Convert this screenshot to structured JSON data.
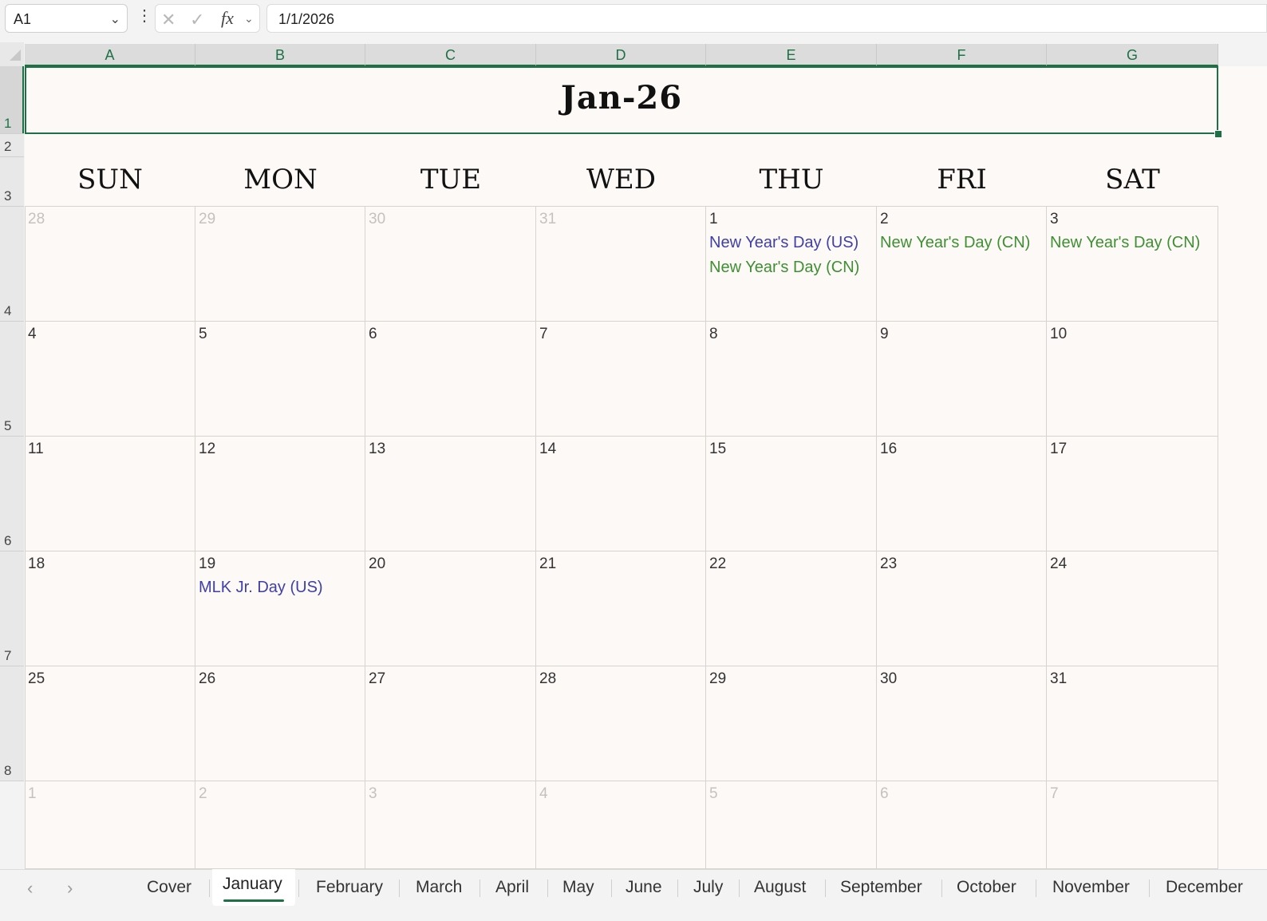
{
  "formula_bar": {
    "name_box": "A1",
    "formula": "1/1/2026"
  },
  "columns": [
    "A",
    "B",
    "C",
    "D",
    "E",
    "F",
    "G"
  ],
  "rows": [
    "1",
    "2",
    "3",
    "4",
    "5",
    "6",
    "7",
    "8"
  ],
  "calendar": {
    "title": "Jan-26",
    "day_names": [
      "SUN",
      "MON",
      "TUE",
      "WED",
      "THU",
      "FRI",
      "SAT"
    ],
    "weeks": [
      [
        {
          "d": "28",
          "o": true
        },
        {
          "d": "29",
          "o": true
        },
        {
          "d": "30",
          "o": true
        },
        {
          "d": "31",
          "o": true
        },
        {
          "d": "1",
          "h": [
            {
              "t": "New Year's Day (US)",
              "k": "us"
            },
            {
              "t": "New Year's Day (CN)",
              "k": "cn"
            }
          ]
        },
        {
          "d": "2",
          "h": [
            {
              "t": "New Year's Day (CN)",
              "k": "cn"
            }
          ]
        },
        {
          "d": "3",
          "h": [
            {
              "t": "New Year's Day (CN)",
              "k": "cn"
            }
          ]
        }
      ],
      [
        {
          "d": "4"
        },
        {
          "d": "5"
        },
        {
          "d": "6"
        },
        {
          "d": "7"
        },
        {
          "d": "8"
        },
        {
          "d": "9"
        },
        {
          "d": "10"
        }
      ],
      [
        {
          "d": "11"
        },
        {
          "d": "12"
        },
        {
          "d": "13"
        },
        {
          "d": "14"
        },
        {
          "d": "15"
        },
        {
          "d": "16"
        },
        {
          "d": "17"
        }
      ],
      [
        {
          "d": "18"
        },
        {
          "d": "19",
          "h": [
            {
              "t": "MLK Jr. Day (US)",
              "k": "us"
            }
          ]
        },
        {
          "d": "20"
        },
        {
          "d": "21"
        },
        {
          "d": "22"
        },
        {
          "d": "23"
        },
        {
          "d": "24"
        }
      ],
      [
        {
          "d": "25"
        },
        {
          "d": "26"
        },
        {
          "d": "27"
        },
        {
          "d": "28"
        },
        {
          "d": "29"
        },
        {
          "d": "30"
        },
        {
          "d": "31"
        }
      ],
      [
        {
          "d": "1",
          "o": true
        },
        {
          "d": "2",
          "o": true
        },
        {
          "d": "3",
          "o": true
        },
        {
          "d": "4",
          "o": true
        },
        {
          "d": "5",
          "o": true
        },
        {
          "d": "6",
          "o": true
        },
        {
          "d": "7",
          "o": true
        }
      ]
    ]
  },
  "sheet_tabs": {
    "active": "January",
    "tabs": [
      "Cover",
      "January",
      "February",
      "March",
      "April",
      "May",
      "June",
      "July",
      "August",
      "September",
      "October",
      "November",
      "December"
    ]
  },
  "colors": {
    "accent": "#1e7145",
    "holiday_us": "#3f3fa8",
    "holiday_cn": "#3f8f33"
  },
  "icons": {
    "name_box_dropdown": "chevron-down-icon",
    "more_options": "vertical-ellipsis-icon",
    "cancel": "close-icon",
    "enter": "check-icon",
    "insert_function": "fx-icon",
    "prev_sheet": "chevron-left-icon",
    "next_sheet": "chevron-right-icon"
  }
}
